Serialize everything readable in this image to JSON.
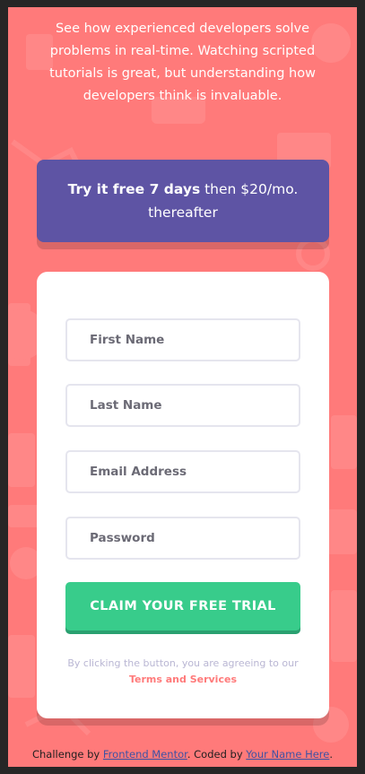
{
  "intro": {
    "text": "See how experienced developers solve problems in real-time. Watching scripted tutorials is great, but understanding how developers think is invaluable."
  },
  "banner": {
    "bold": "Try it free 7 days",
    "rest": " then $20/mo. thereafter"
  },
  "form": {
    "first_name": {
      "placeholder": "First Name",
      "value": ""
    },
    "last_name": {
      "placeholder": "Last Name",
      "value": ""
    },
    "email": {
      "placeholder": "Email Address",
      "value": ""
    },
    "password": {
      "placeholder": "Password",
      "value": ""
    },
    "submit_label": "CLAIM YOUR FREE TRIAL",
    "terms_text": "By clicking the button, you are agreeing to our",
    "terms_link": "Terms and Services"
  },
  "footer": {
    "prefix": "Challenge by ",
    "challenge_link": "Frontend Mentor",
    "middle": ". Coded by ",
    "author_link": "Your Name Here",
    "suffix": "."
  },
  "colors": {
    "background": "#ff7a7a",
    "banner": "#5e54a4",
    "cta": "#38cc8b",
    "terms_link": "#ff7a7a"
  }
}
